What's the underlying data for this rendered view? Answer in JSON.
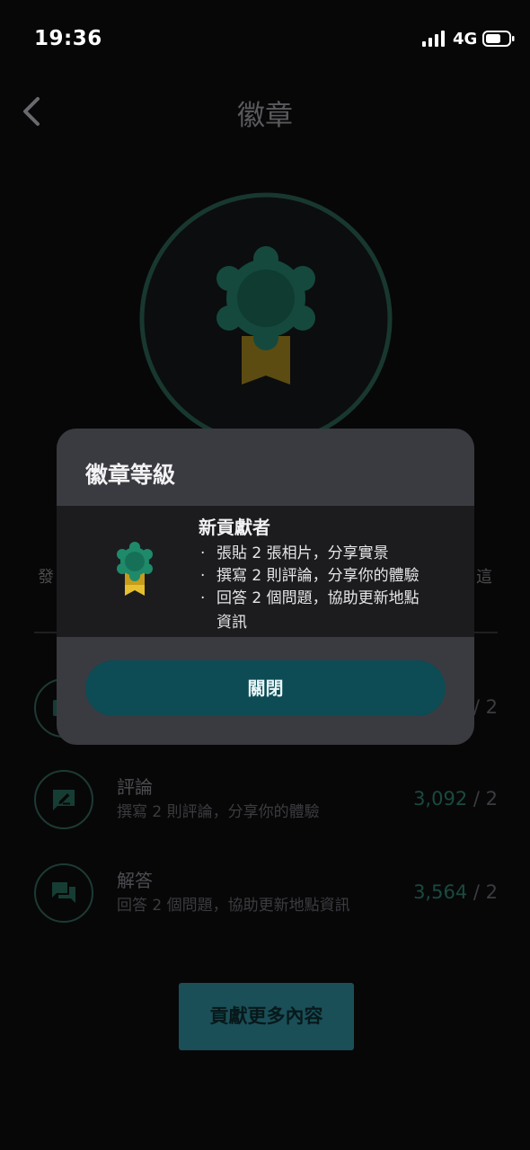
{
  "status_bar": {
    "time": "19:36",
    "network": "4G"
  },
  "header": {
    "title": "徽章"
  },
  "background_rows": {
    "left_fragment": "發",
    "right_fragment": "這",
    "items": [
      {
        "title": "",
        "desc": "",
        "count": "",
        "target": "/ 2"
      },
      {
        "title": "評論",
        "desc": "撰寫 2 則評論，分享你的體驗",
        "count": "3,092",
        "target": "/ 2"
      },
      {
        "title": "解答",
        "desc": "回答 2 個問題，協助更新地點資訊",
        "count": "3,564",
        "target": "/ 2"
      }
    ]
  },
  "cta": {
    "label": "貢獻更多內容"
  },
  "modal": {
    "title": "徽章等級",
    "level_name": "新貢獻者",
    "bullet": "·",
    "requirements": [
      "張貼 2 張相片，分享實景",
      "撰寫 2 則評論，分享你的體驗",
      "回答 2 個問題，協助更新地點"
    ],
    "requirement_cont": "資訊",
    "close_label": "關閉"
  },
  "colors": {
    "background": "#070708",
    "modal": "#3a3b40",
    "accent_teal": "#0d4b55",
    "badge_green": "#1d7a60",
    "ribbon_yellow": "#d4a72c"
  }
}
